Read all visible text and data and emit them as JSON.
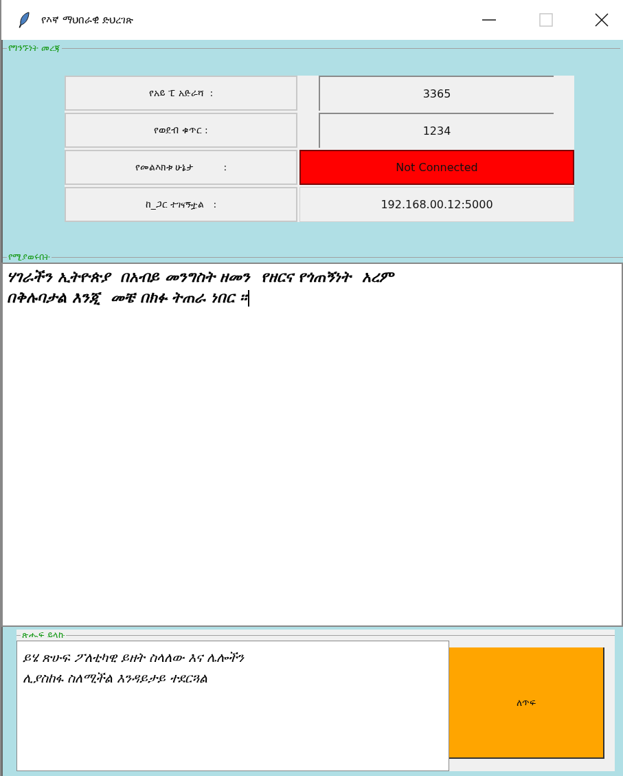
{
  "window": {
    "title": "የእኛ ማህበራዊ ድህረገጽ"
  },
  "connection": {
    "legend": "የግንኙነት መረጃ",
    "rows": [
      {
        "label": "የአይ ፒ አድራሻ  :",
        "value": "3365",
        "kind": "field"
      },
      {
        "label": "የወደብ ቁጥር :",
        "value": "1234",
        "kind": "field"
      },
      {
        "label": "የመልእክቱ ሁኔታ          :",
        "value": "Not Connected",
        "kind": "status"
      },
      {
        "label": "ከ_ጋር ተገናኝቷል   :",
        "value": "192.168.00.12:5000",
        "kind": "plain"
      }
    ]
  },
  "chat": {
    "legend": "የሚያወሩበት",
    "lines": [
      "ሃገራችን ኢትዮጵያ  በአብይ መንግስት ዘመን  የዘርና የጎጠኝነት  አረም",
      "በቅሉባታል እንጂ  መቼ በክፉ ትጠራ ነበር ።"
    ]
  },
  "compose": {
    "legend": "ጽሑፍ ይላኩ",
    "lines": [
      "ይሄ ጽሁፍ ፖለቲካዊ ይዘት ስላለው እና ሌሎችን",
      "ሊያስከፋ ስለሚችል እንዳይታይ ተደርጓል"
    ],
    "button": "ለጥፍ"
  }
}
